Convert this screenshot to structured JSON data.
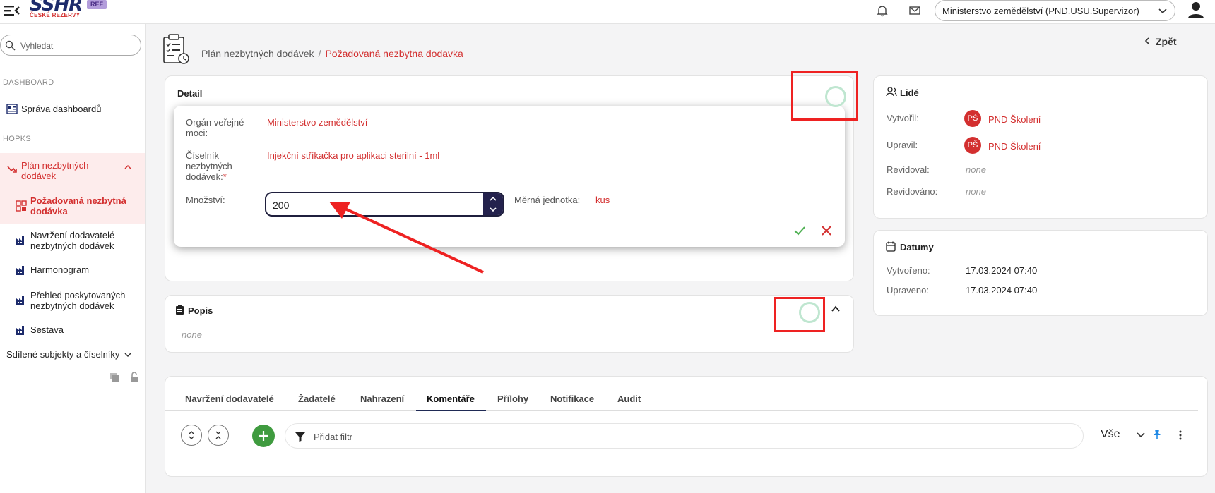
{
  "topbar": {
    "logo_main": "SSHR",
    "logo_sub": "ČESKÉ REZERVY",
    "ref_badge": "REF",
    "org_select": "Ministerstvo zemědělství (PND.USU.Supervizor)"
  },
  "sidebar": {
    "search_placeholder": "Vyhledat",
    "section_dashboard": "DASHBOARD",
    "dashboard_item": "Správa dashboardů",
    "section_hopks": "HOPKS",
    "items": [
      {
        "label": "Plán nezbytných dodávek"
      },
      {
        "label": "Požadovaná nezbytná dodávka"
      },
      {
        "label": "Navržení dodavatelé nezbytných dodávek"
      },
      {
        "label": "Harmonogram"
      },
      {
        "label": "Přehled poskytovaných nezbytných dodávek"
      },
      {
        "label": "Sestava"
      }
    ],
    "shared_label": "Sdílené subjekty a číselníky"
  },
  "header": {
    "breadcrumb_parent": "Plán nezbytných dodávek",
    "breadcrumb_separator": "/",
    "breadcrumb_current": "Požadovaná nezbytna dodavka",
    "back_label": "Zpět"
  },
  "detail": {
    "title": "Detail",
    "organ_label": "Orgán veřejné moci:",
    "organ_value": "Ministerstvo zemědělství",
    "ciselnik_label": "Číselník nezbytných dodávek:",
    "ciselnik_required": "*",
    "ciselnik_value": "Injekční stříkačka pro aplikaci sterilní - 1ml",
    "mnozstvi_label": "Množství:",
    "mnozstvi_value": "200",
    "jednotka_label": "Měrná jednotka:",
    "jednotka_value": "kus"
  },
  "popis": {
    "title": "Popis",
    "value": "none"
  },
  "lide": {
    "title": "Lidé",
    "vytvoril_label": "Vytvořil:",
    "vytvoril_initials": "PŠ",
    "vytvoril_value": "PND Školení",
    "upravil_label": "Upravil:",
    "upravil_initials": "PŠ",
    "upravil_value": "PND Školení",
    "revidoval_label": "Revidoval:",
    "revidoval_value": "none",
    "revidovano_label": "Revidováno:",
    "revidovano_value": "none"
  },
  "datumy": {
    "title": "Datumy",
    "vytvoreno_label": "Vytvořeno:",
    "vytvoreno_value": "17.03.2024 07:40",
    "upraveno_label": "Upraveno:",
    "upraveno_value": "17.03.2024 07:40"
  },
  "tabs": [
    {
      "label": "Navržení dodavatelé"
    },
    {
      "label": "Žadatelé"
    },
    {
      "label": "Nahrazení"
    },
    {
      "label": "Komentáře"
    },
    {
      "label": "Přílohy"
    },
    {
      "label": "Notifikace"
    },
    {
      "label": "Audit"
    }
  ],
  "toolbar": {
    "filter_placeholder": "Přidat filtr",
    "scope_value": "Vše"
  },
  "colors": {
    "accent_red": "#d32f2f",
    "navy": "#1d2b6b",
    "green": "#3f9b3f",
    "annotation_red": "#ee2222"
  }
}
